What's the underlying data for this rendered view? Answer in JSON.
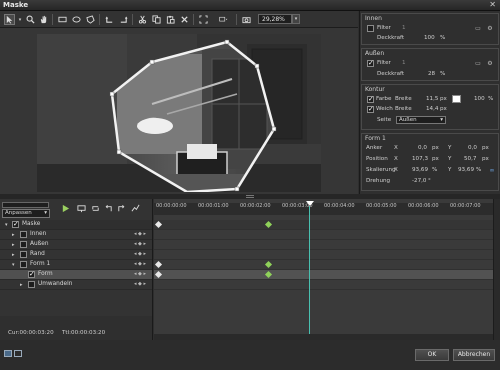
{
  "window": {
    "title": "Maske",
    "close_glyph": "✕"
  },
  "toolbar": {
    "icons": [
      "select-icon",
      "zoom-icon",
      "hand-icon",
      "rectangle-icon",
      "ellipse-icon",
      "polygon-icon",
      "undo-icon",
      "redo-icon",
      "cut-icon",
      "copy-icon",
      "paste-icon",
      "delete-icon",
      "fit-icon",
      "display-icon"
    ],
    "zoom_value": "29,28%",
    "zoom_arrow": "▾"
  },
  "panel": {
    "innen": {
      "title": "Innen",
      "filter_label": "Filter",
      "filter_value": "1",
      "deckkraft_label": "Deckkraft",
      "deckkraft_value": "100",
      "deckkraft_unit": "%"
    },
    "aussen": {
      "title": "Außen",
      "filter_label": "Filter",
      "filter_value": "1",
      "deckkraft_label": "Deckkraft",
      "deckkraft_value": "28",
      "deckkraft_unit": "%"
    },
    "kontur": {
      "title": "Kontur",
      "farbe_label": "Farbe",
      "farbe_breite_label": "Breite",
      "farbe_breite_value": "11,5",
      "farbe_unit": "px",
      "farbe_percent": "100",
      "farbe_percent_unit": "%",
      "farbe_swatch": "#ffffff",
      "weich_label": "Weich",
      "weich_breite_label": "Breite",
      "weich_breite_value": "14,4",
      "weich_unit": "px",
      "seite_label": "Seite",
      "seite_value": "Außen",
      "seite_arrow": "▾"
    },
    "form": {
      "title": "Form 1",
      "anker_label": "Anker",
      "anker_x": "0,0",
      "anker_y": "0,0",
      "position_label": "Position",
      "position_x": "107,3",
      "position_y": "50,7",
      "skalierung_label": "Skalierung",
      "skalierung_x": "93,69",
      "skalierung_y": "93,69",
      "drehung_label": "Drehung",
      "drehung_value": "-27,0",
      "drehung_unit": "°",
      "x_label": "X",
      "y_label": "Y",
      "px_unit": "px",
      "pct_unit": "%"
    }
  },
  "timeline": {
    "fit_label": "Anpassen",
    "fit_arrow": "▾",
    "tracks": [
      {
        "name": "Maske",
        "expander": "▾",
        "checked": true,
        "keys": ""
      },
      {
        "name": "Innen",
        "expander": "▸",
        "checked": false,
        "keys": "◂ ◆ ▸"
      },
      {
        "name": "Außen",
        "expander": "▸",
        "checked": false,
        "keys": "◂ ◆ ▸"
      },
      {
        "name": "Rand",
        "expander": "▸",
        "checked": false,
        "keys": "◂ ◆ ▸"
      },
      {
        "name": "Form 1",
        "expander": "▾",
        "checked": false,
        "keys": "◂ ◆ ▸"
      },
      {
        "name": "Form",
        "expander": "",
        "checked": true,
        "keys": "◂ ◆ ▸"
      },
      {
        "name": "Umwandeln",
        "expander": "▸",
        "checked": false,
        "keys": "◂ ◆ ▸"
      }
    ],
    "ruler": [
      "00:00:00:00",
      "00:00:01:00",
      "00:00:02:00",
      "00:00:03:00",
      "00:00:04:00",
      "00:00:05:00",
      "00:00:06:00",
      "00:00:07:00"
    ],
    "cur_label": "Cur:00:00:03:20",
    "ttl_label": "Ttl:00:00:03:20"
  },
  "footer": {
    "ok_label": "OK",
    "cancel_label": "Abbrechen"
  }
}
